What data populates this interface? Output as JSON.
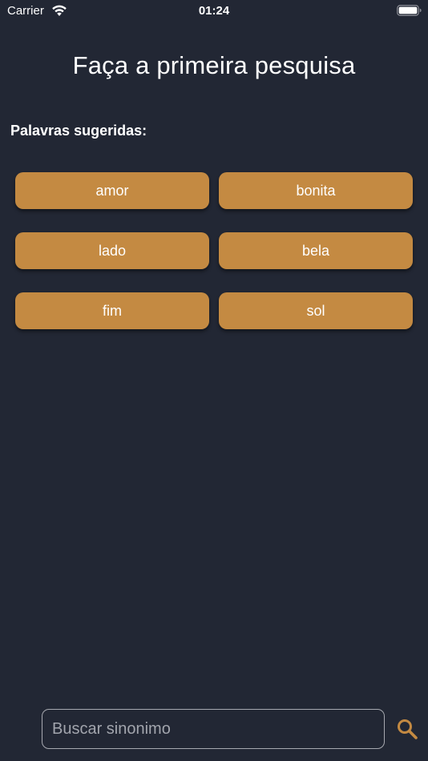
{
  "status_bar": {
    "carrier": "Carrier",
    "time": "01:24",
    "wifi_icon": "wifi-icon",
    "battery_icon": "battery-icon"
  },
  "title": "Faça a primeira pesquisa",
  "suggestions": {
    "label": "Palavras sugeridas:",
    "items": [
      "amor",
      "bonita",
      "lado",
      "bela",
      "fim",
      "sol"
    ]
  },
  "search": {
    "value": "",
    "placeholder": "Buscar sinonimo",
    "button_icon": "search-icon"
  },
  "colors": {
    "background": "#222734",
    "accent": "#c48a42",
    "text": "#ffffff",
    "placeholder": "#a2a5ad"
  }
}
